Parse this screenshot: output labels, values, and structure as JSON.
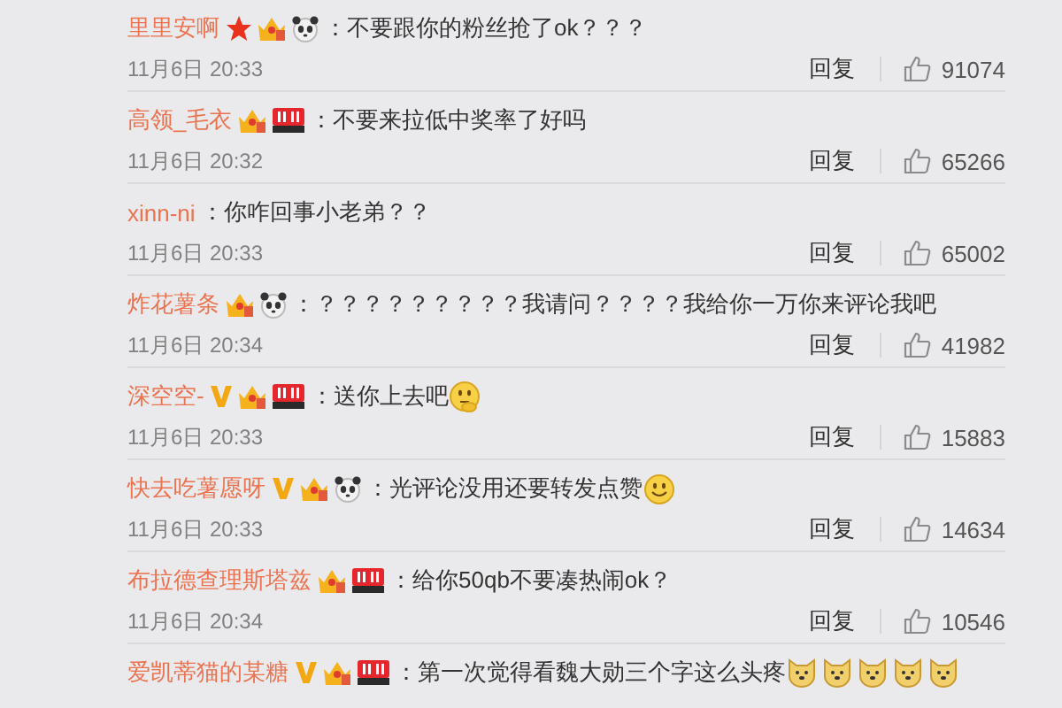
{
  "comments": [
    {
      "name": "里里安啊",
      "badges": [
        {
          "kind": "star"
        },
        {
          "kind": "crown"
        },
        {
          "kind": "panda"
        }
      ],
      "text": "：不要跟你的粉丝抢了ok？？？",
      "time": "11月6日 20:33",
      "reply": "回复",
      "likes": "91074"
    },
    {
      "name": "高领_毛衣",
      "badges": [
        {
          "kind": "crown"
        },
        {
          "kind": "shop"
        }
      ],
      "text": "：不要来拉低中奖率了好吗",
      "time": "11月6日 20:32",
      "reply": "回复",
      "likes": "65266"
    },
    {
      "name": "xinn-ni",
      "text": "：你咋回事小老弟？？",
      "time": "11月6日 20:33",
      "reply": "回复",
      "likes": "65002"
    },
    {
      "name": "炸花薯条",
      "badges": [
        {
          "kind": "crown"
        },
        {
          "kind": "panda"
        }
      ],
      "text": "：？？？？？？？？？我请问？？？？我给你一万你来评论我吧",
      "time": "11月6日 20:34",
      "reply": "回复",
      "likes": "41982"
    },
    {
      "name": "深空空-",
      "badges": [
        {
          "kind": "v"
        },
        {
          "kind": "crown"
        },
        {
          "kind": "shop"
        }
      ],
      "text": "：送你上去吧",
      "emojis": [
        {
          "kind": "thinking"
        }
      ],
      "time": "11月6日 20:33",
      "reply": "回复",
      "likes": "15883"
    },
    {
      "name": "快去吃薯愿呀",
      "badges": [
        {
          "kind": "v"
        },
        {
          "kind": "crown"
        },
        {
          "kind": "panda"
        }
      ],
      "text": "：光评论没用还要转发点赞",
      "emojis": [
        {
          "kind": "smile"
        }
      ],
      "time": "11月6日 20:33",
      "reply": "回复",
      "likes": "14634"
    },
    {
      "name": "布拉德查理斯塔兹",
      "badges": [
        {
          "kind": "crown"
        },
        {
          "kind": "shop"
        }
      ],
      "text": "：给你50qb不要凑热闹ok？",
      "time": "11月6日 20:34",
      "reply": "回复",
      "likes": "10546"
    },
    {
      "name": "爱凯蒂猫的某糖",
      "badges": [
        {
          "kind": "v"
        },
        {
          "kind": "crown"
        },
        {
          "kind": "shop"
        }
      ],
      "text": "：第一次觉得看魏大勋三个字这么头疼",
      "emojis": [
        {
          "kind": "doge"
        },
        {
          "kind": "doge"
        },
        {
          "kind": "doge"
        },
        {
          "kind": "doge"
        },
        {
          "kind": "doge"
        }
      ]
    }
  ]
}
